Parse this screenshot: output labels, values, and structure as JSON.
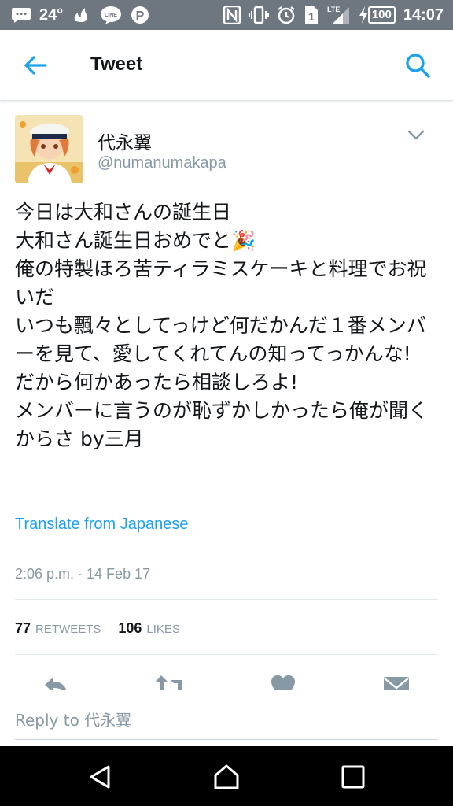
{
  "status_bar": {
    "temperature": "24°",
    "time": "14:07",
    "battery": "100",
    "sim_slot": "1",
    "network": "LTE"
  },
  "header": {
    "title": "Tweet"
  },
  "tweet": {
    "display_name": "代永翼",
    "handle": "@numanumakapa",
    "text": "今日は大和さんの誕生日\n大和さん誕生日おめでと🎉\n俺の特製ほろ苦ティラミスケーキと料理でお祝いだ\nいつも飄々としてっけど何だかんだ１番メンバーを見て、愛してくれてんの知ってっかんな!\nだから何かあったら相談しろよ!\nメンバーに言うのが恥ずかしかったら俺が聞くからさ by三月",
    "translate_label": "Translate from Japanese",
    "timestamp": "2:06 p.m. · 14 Feb 17",
    "retweets_count": "77",
    "retweets_label": "RETWEETS",
    "likes_count": "106",
    "likes_label": "LIKES"
  },
  "reply": {
    "placeholder": "Reply to 代永翼"
  },
  "colors": {
    "accent": "#1da1f2",
    "muted": "#8899a6",
    "status_bar": "#6e7680"
  }
}
